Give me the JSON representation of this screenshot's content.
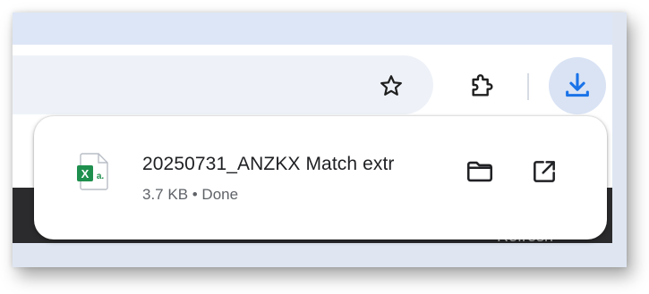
{
  "toolbar": {
    "bookmark_icon": "star-icon",
    "extensions_icon": "puzzle-icon",
    "downloads_icon": "download-icon",
    "accent_color": "#1a73e8"
  },
  "background_text": "Refresh",
  "download": {
    "file_name": "20250731_ANZKX Match extr",
    "file_icon": "excel-file-icon",
    "file_icon_letters": "X",
    "file_icon_sub": "a.",
    "meta": "3.7 KB • Done",
    "actions": {
      "show_in_folder_icon": "folder-icon",
      "open_icon": "open-external-icon"
    },
    "excel_green": "#1f8f4e"
  }
}
